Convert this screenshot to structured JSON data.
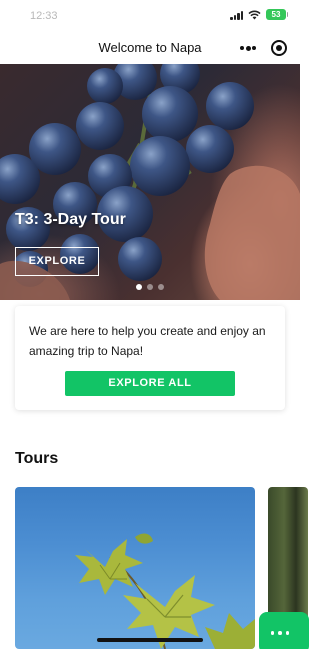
{
  "status_bar": {
    "time": "12:33",
    "battery": "53"
  },
  "nav": {
    "title": "Welcome to Napa",
    "more_icon": "more-dots-icon",
    "target_icon": "target-icon"
  },
  "hero": {
    "title": "T3: 3-Day Tour",
    "button_label": "EXPLORE",
    "slide_count": 3,
    "active_slide": 1
  },
  "intro": {
    "text": "We are here to help you create and enjoy an amazing trip to Napa!",
    "button_label": "EXPLORE ALL"
  },
  "tours": {
    "section_title": "Tours"
  },
  "colors": {
    "accent_green": "#12c466",
    "battery_green": "#34c759"
  }
}
